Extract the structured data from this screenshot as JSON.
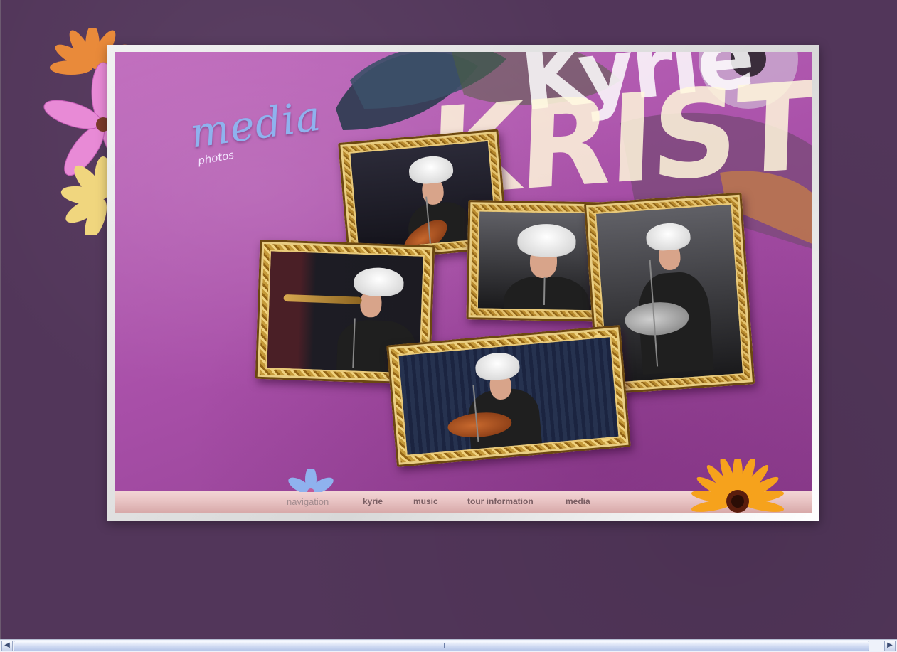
{
  "site": {
    "logo_line1": "Kyrie",
    "logo_line2": "KRIST"
  },
  "section": {
    "title": "media",
    "subtitle": "photos"
  },
  "gallery": {
    "photos": [
      {
        "name": "photo-singing-guitar"
      },
      {
        "name": "photo-trumpet"
      },
      {
        "name": "photo-closeup-mic"
      },
      {
        "name": "photo-bw-guitar"
      },
      {
        "name": "photo-seated-guitar"
      }
    ]
  },
  "navigation": {
    "label": "navigation",
    "items": [
      "kyrie",
      "music",
      "tour information",
      "media"
    ]
  },
  "colors": {
    "page_bg": "#52365a",
    "stage_purple": "#a84fa8",
    "title_blue": "#8fb2ee",
    "nav_text": "#7a5e63",
    "frame_gold": "#c59a3a"
  },
  "icons": {
    "scroll_left": "◀",
    "scroll_right": "▶"
  }
}
